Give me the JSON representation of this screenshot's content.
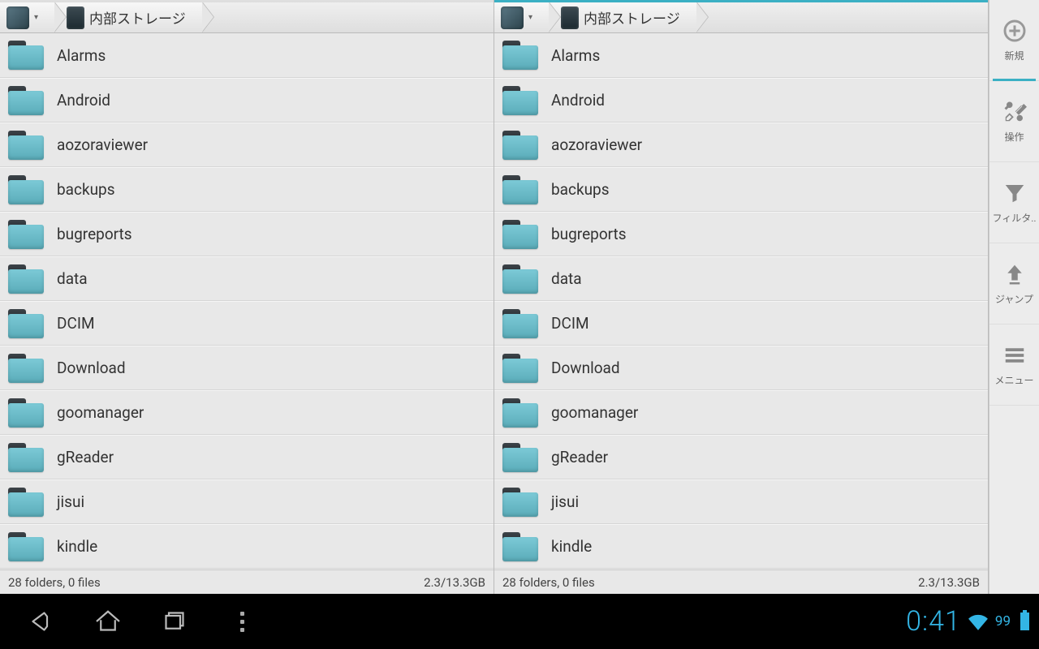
{
  "breadcrumb": {
    "storage_label": "内部ストレージ"
  },
  "folders": [
    {
      "name": "Alarms"
    },
    {
      "name": "Android"
    },
    {
      "name": "aozoraviewer"
    },
    {
      "name": "backups"
    },
    {
      "name": "bugreports"
    },
    {
      "name": "data"
    },
    {
      "name": "DCIM"
    },
    {
      "name": "Download"
    },
    {
      "name": "goomanager"
    },
    {
      "name": "gReader"
    },
    {
      "name": "jisui"
    },
    {
      "name": "kindle"
    }
  ],
  "status": {
    "summary": "28 folders, 0 files",
    "usage": "2.3/13.3GB"
  },
  "sidebar": {
    "new": "新規",
    "ops": "操作",
    "filter": "フィルタ..",
    "jump": "ジャンプ",
    "menu": "メニュー"
  },
  "statusbar": {
    "clock": "0:41",
    "battery_pct": "99"
  }
}
